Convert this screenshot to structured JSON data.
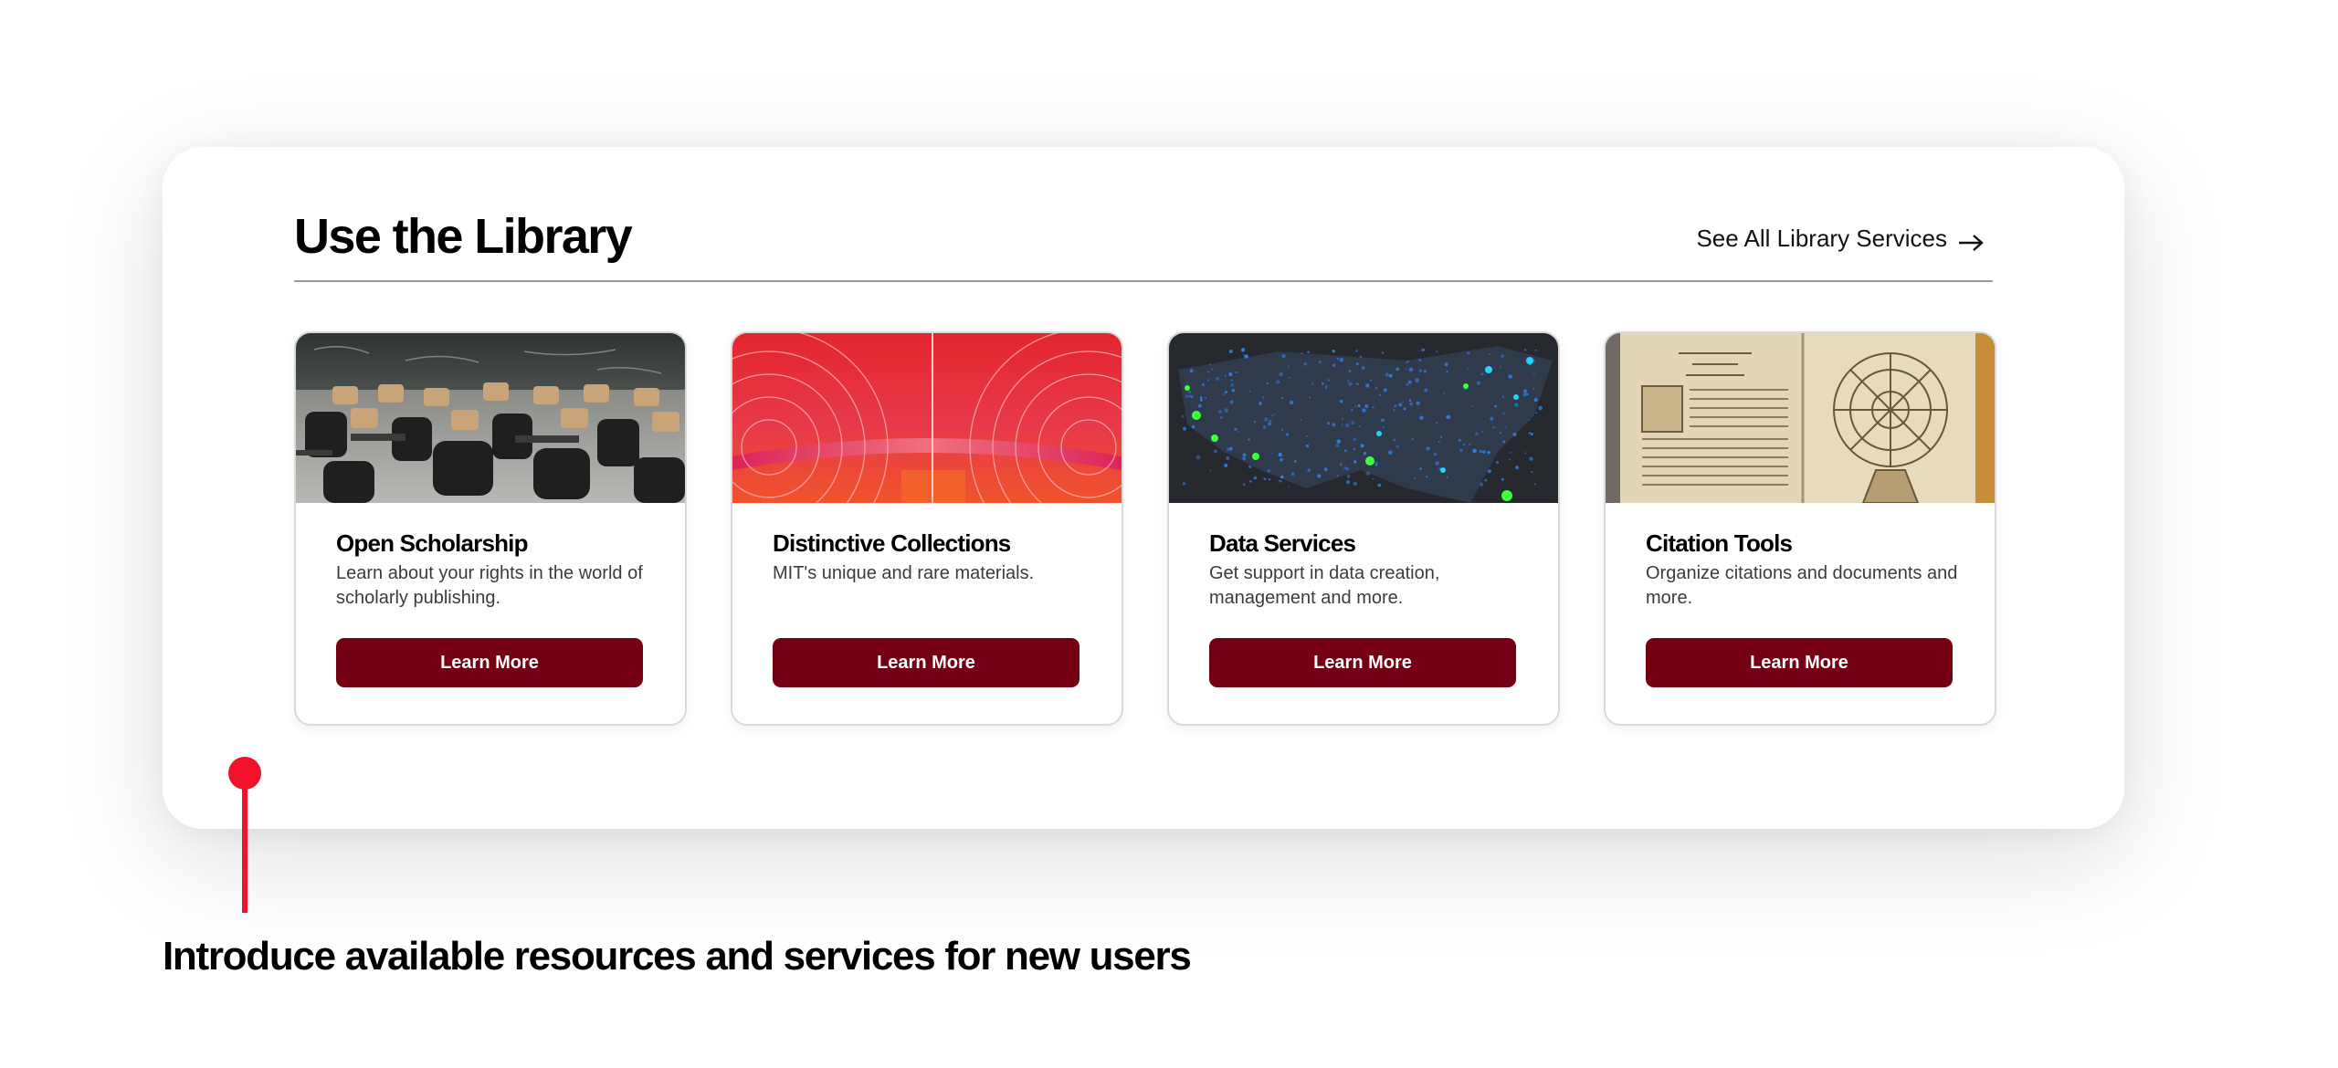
{
  "section": {
    "title": "Use the Library",
    "see_all_label": "See All Library Services"
  },
  "cards": [
    {
      "title": "Open Scholarship",
      "description": "Learn about your rights in the world of scholarly publishing.",
      "button_label": "Learn More",
      "image": "classroom-photo"
    },
    {
      "title": "Distinctive Collections",
      "description": "MIT's unique and rare materials.",
      "button_label": "Learn More",
      "image": "red-concentric-circles-art"
    },
    {
      "title": "Data Services",
      "description": "Get support in data creation, management and more.",
      "button_label": "Learn More",
      "image": "us-data-dot-map"
    },
    {
      "title": "Citation Tools",
      "description": "Organize citations and documents and more.",
      "button_label": "Learn More",
      "image": "antique-book-astrolabe"
    }
  ],
  "annotation": {
    "text": "Introduce available resources and services for new users"
  },
  "colors": {
    "button": "#750014",
    "annotation_accent": "#f2132b",
    "divider": "#9a9a9a"
  },
  "icons": {
    "see_all": "arrow-right-icon"
  }
}
